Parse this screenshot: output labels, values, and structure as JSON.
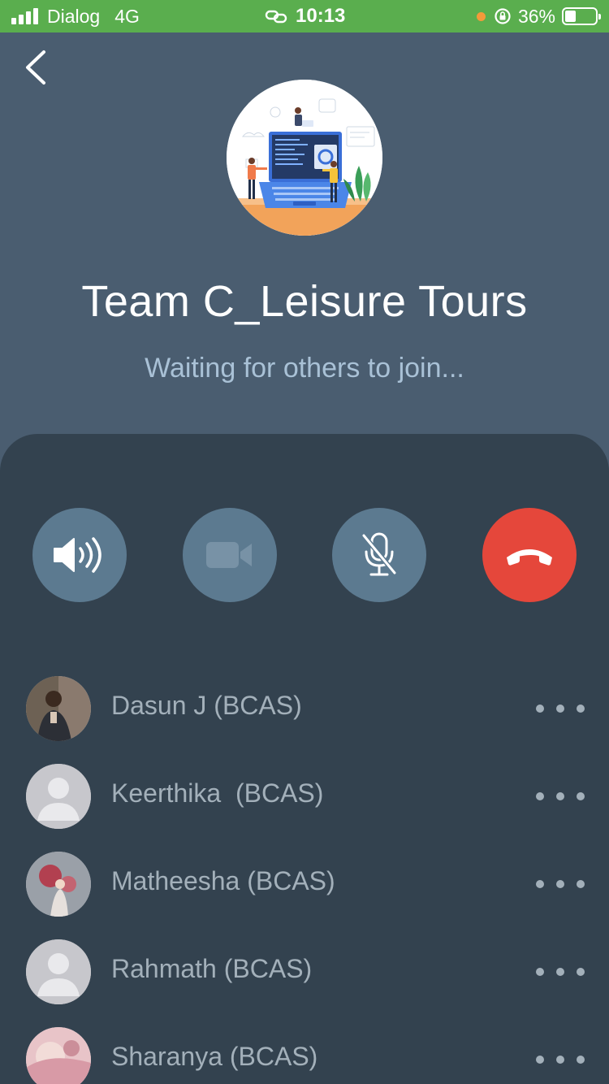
{
  "status_bar": {
    "carrier": "Dialog",
    "network": "4G",
    "time": "10:13",
    "battery": "36%",
    "battery_level": 0.36
  },
  "call": {
    "title": "Team C_Leisure Tours",
    "status": "Waiting for others to join..."
  },
  "controls": [
    {
      "name": "speaker",
      "icon": "speaker-icon"
    },
    {
      "name": "video",
      "icon": "video-camera-icon"
    },
    {
      "name": "mute",
      "icon": "mic-off-icon"
    },
    {
      "name": "end-call",
      "icon": "phone-hangup-icon"
    }
  ],
  "participants": [
    {
      "name": "Dasun J (BCAS)",
      "avatar": "photo"
    },
    {
      "name": "Keerthika  (BCAS)",
      "avatar": "default"
    },
    {
      "name": "Matheesha (BCAS)",
      "avatar": "photo"
    },
    {
      "name": "Rahmath (BCAS)",
      "avatar": "default"
    },
    {
      "name": "Sharanya (BCAS)",
      "avatar": "photo"
    }
  ],
  "colors": {
    "status_bar": "#5aae4e",
    "header_bg": "#4a5d70",
    "panel_bg": "#33424f",
    "control_button": "#5c7a90",
    "end_call": "#e5473b",
    "subtitle": "#a9c1d6"
  }
}
